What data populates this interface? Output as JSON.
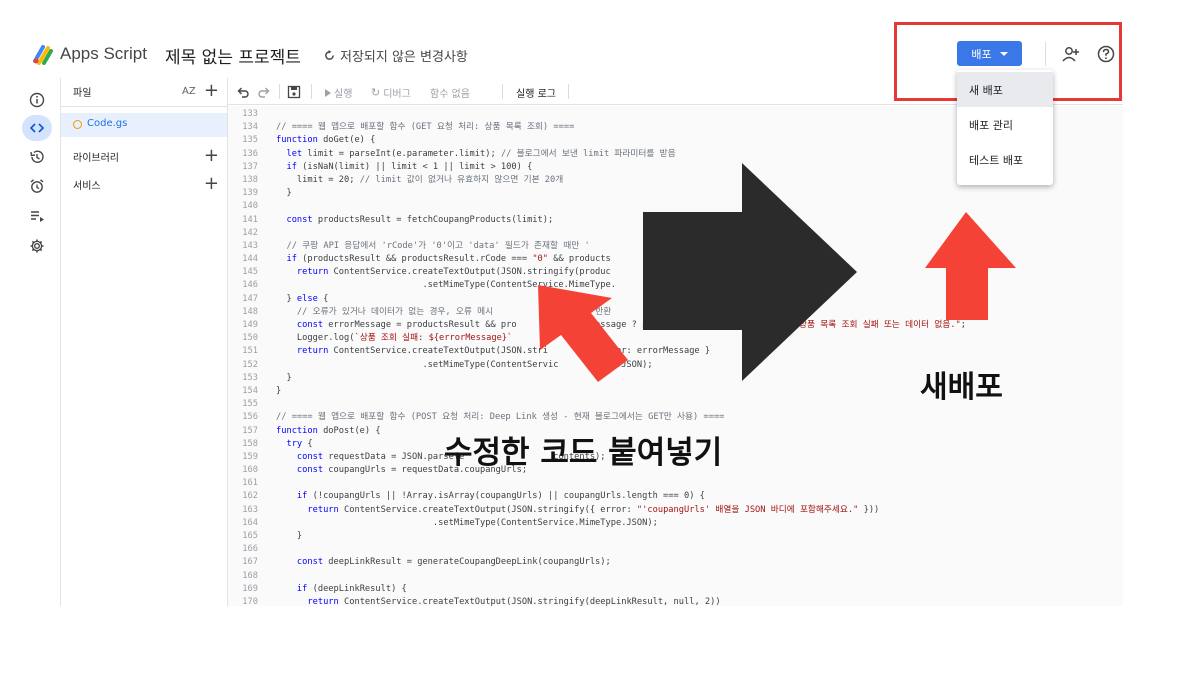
{
  "header": {
    "app_name": "Apps Script",
    "project_title": "제목 없는 프로젝트",
    "unsaved": "저장되지 않은 변경사항",
    "deploy_label": "배포"
  },
  "deploy_menu": {
    "items": [
      "새 배포",
      "배포 관리",
      "테스트 배포"
    ]
  },
  "files_panel": {
    "files_label": "파일",
    "sort_label": "AZ",
    "file_name": "Code.gs",
    "libraries_label": "라이브러리",
    "services_label": "서비스"
  },
  "toolbar": {
    "run": "실행",
    "debug": "디버그",
    "function": "함수 없음",
    "log": "실행 로그"
  },
  "code": [
    {
      "n": "133",
      "t": ""
    },
    {
      "n": "134",
      "t": "// ==== 웹 앱으로 배포할 함수 (GET 요청 처리: 상품 목록 조회) ===="
    },
    {
      "n": "135",
      "t": "function doGet(e) {"
    },
    {
      "n": "136",
      "t": "  let limit = parseInt(e.parameter.limit); // 블로그에서 보낸 limit 파라미터를 받음"
    },
    {
      "n": "137",
      "t": "  if (isNaN(limit) || limit < 1 || limit > 100) {"
    },
    {
      "n": "138",
      "t": "    limit = 20; // limit 값이 없거나 유효하지 않으면 기본 20개"
    },
    {
      "n": "139",
      "t": "  }"
    },
    {
      "n": "140",
      "t": ""
    },
    {
      "n": "141",
      "t": "  const productsResult = fetchCoupangProducts(limit);"
    },
    {
      "n": "142",
      "t": ""
    },
    {
      "n": "143",
      "t": "  // 쿠팡 API 응답에서 'rCode'가 '0'이고 'data' 필드가 존재할 때만 '"
    },
    {
      "n": "144",
      "t": "  if (productsResult && productsResult.rCode === \"0\" && products"
    },
    {
      "n": "145",
      "t": "    return ContentService.createTextOutput(JSON.stringify(produc"
    },
    {
      "n": "146",
      "t": "                            .setMimeType(ContentService.MimeType."
    },
    {
      "n": "147",
      "t": "  } else {"
    },
    {
      "n": "148",
      "t": "    // 오류가 있거나 데이터가 없는 경우, 오류 메시                 여 반환"
    },
    {
      "n": "149",
      "t": "    const errorMessage = productsResult && pro          lt.rMessage ? productsResul        ssage : \"상품 목록 조회 실패 또는 데이터 없음.\";"
    },
    {
      "n": "150",
      "t": "    Logger.log(`상품 조회 실패: ${errorMessage}`"
    },
    {
      "n": "151",
      "t": "    return ContentService.createTextOutput(JSON.stri          error: errorMessage }"
    },
    {
      "n": "152",
      "t": "                            .setMimeType(ContentServic        ype.JSON);"
    },
    {
      "n": "153",
      "t": "  }"
    },
    {
      "n": "154",
      "t": "}"
    },
    {
      "n": "155",
      "t": ""
    },
    {
      "n": "156",
      "t": "// ==== 웹 앱으로 배포할 함수 (POST 요청 처리: Deep Link 생성 - 현재 블로그에서는 GET만 사용) ===="
    },
    {
      "n": "157",
      "t": "function doPost(e) {"
    },
    {
      "n": "158",
      "t": "  try {"
    },
    {
      "n": "159",
      "t": "    const requestData = JSON.parse(e                 contents);"
    },
    {
      "n": "160",
      "t": "    const coupangUrls = requestData.coupangUrls;"
    },
    {
      "n": "161",
      "t": ""
    },
    {
      "n": "162",
      "t": "    if (!coupangUrls || !Array.isArray(coupangUrls) || coupangUrls.length === 0) {"
    },
    {
      "n": "163",
      "t": "      return ContentService.createTextOutput(JSON.stringify({ error: \"'coupangUrls' 배열을 JSON 바디에 포함해주세요.\" }))"
    },
    {
      "n": "164",
      "t": "                              .setMimeType(ContentService.MimeType.JSON);"
    },
    {
      "n": "165",
      "t": "    }"
    },
    {
      "n": "166",
      "t": ""
    },
    {
      "n": "167",
      "t": "    const deepLinkResult = generateCoupangDeepLink(coupangUrls);"
    },
    {
      "n": "168",
      "t": ""
    },
    {
      "n": "169",
      "t": "    if (deepLinkResult) {"
    },
    {
      "n": "170",
      "t": "      return ContentService.createTextOutput(JSON.stringify(deepLinkResult, null, 2))"
    }
  ],
  "annotations": {
    "paste_code": "수정한 코드 붙여넣기",
    "new_deploy": "새배포",
    "arrow_color": "#f44336",
    "box_color": "#e53935",
    "big_arrow_color": "#2b2b2b"
  },
  "colors": {
    "accent": "#3b78e7",
    "keyword": "#0000ff",
    "string": "#a31515",
    "comment": "#6a737d"
  }
}
